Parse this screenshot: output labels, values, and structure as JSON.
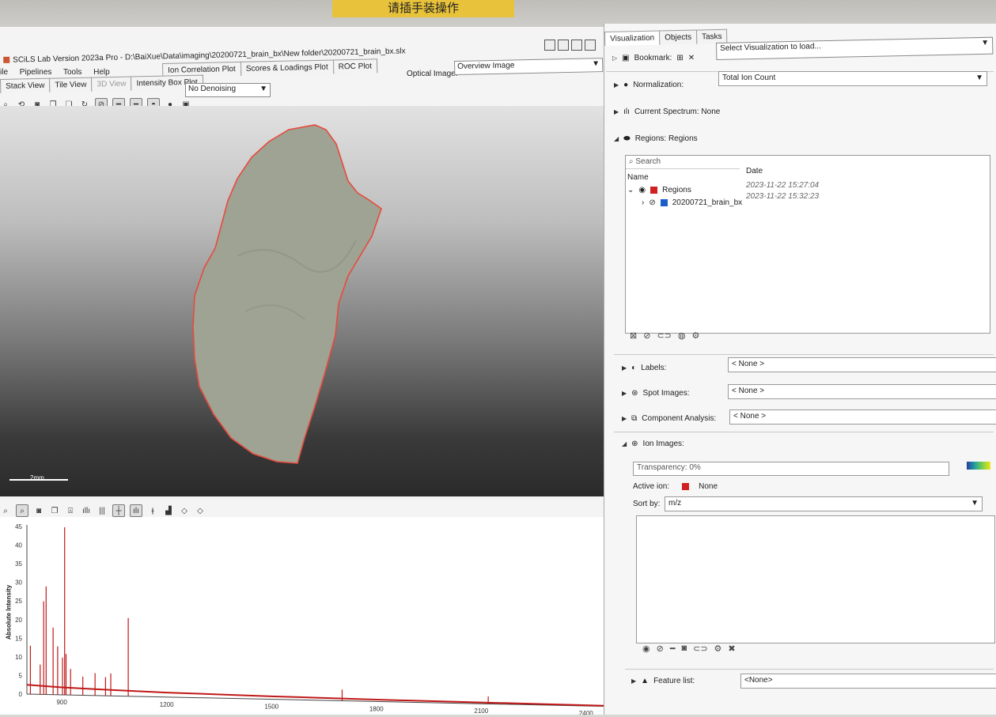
{
  "banner": {
    "text": "请插手装操作"
  },
  "window": {
    "title": "SCiLS Lab Version 2023a Pro - D:\\BaiXue\\Data\\imaging\\20200721_brain_bx\\New folder\\20200721_brain_bx.slx"
  },
  "menu": [
    "ile",
    "Pipelines",
    "Tools",
    "Help"
  ],
  "plot_tabs": [
    "Ion Correlation Plot",
    "Scores & Loadings Plot",
    "ROC Plot"
  ],
  "view_tabs": [
    "Stack View",
    "Tile View",
    "3D View",
    "Intensity Box Plot"
  ],
  "optical": {
    "label": "Optical Image:",
    "value": "Overview Image"
  },
  "denoise": {
    "value": "No Denoising"
  },
  "scale_bar": {
    "label": "2mm"
  },
  "spectrum": {
    "ylabel": "Absolute Intensity",
    "yticks": [
      "45",
      "40",
      "35",
      "30",
      "25",
      "20",
      "15",
      "10",
      "5",
      "0"
    ],
    "xticks": [
      "900",
      "1200",
      "1500",
      "1800",
      "2100",
      "2400"
    ]
  },
  "chart_data": {
    "type": "line",
    "title": "",
    "xlabel": "",
    "ylabel": "Absolute Intensity",
    "xlim": [
      800,
      2500
    ],
    "ylim": [
      0,
      45
    ],
    "peaks": {
      "x": [
        810,
        838,
        848,
        855,
        875,
        888,
        902,
        908,
        912,
        925,
        960,
        995,
        1025,
        1040,
        1090,
        1702,
        2120
      ],
      "y": [
        13,
        8,
        25,
        29,
        18,
        13,
        10,
        45,
        11,
        7,
        5,
        6,
        5,
        6,
        21,
        3,
        2
      ]
    },
    "baseline": {
      "x": [
        780,
        900,
        1000,
        1200,
        1500,
        1800,
        2100,
        2400,
        2500
      ],
      "y": [
        2.5,
        2,
        1.7,
        1.2,
        0.8,
        0.5,
        0.35,
        0.2,
        0.15
      ]
    }
  },
  "right_tabs": [
    "Visualization",
    "Objects",
    "Tasks"
  ],
  "bookmark": {
    "label": "Bookmark:",
    "value": "Select Visualization to load..."
  },
  "normalization": {
    "label": "Normalization:",
    "value": "Total Ion Count"
  },
  "current_spectrum": {
    "label": "Current Spectrum: None"
  },
  "regions": {
    "header": "Regions: Regions",
    "search_placeholder": "Search",
    "col_name": "Name",
    "col_date": "Date",
    "rows": [
      {
        "name": "Regions",
        "date": "2023-11-22 15:27:04",
        "color": "#d02020"
      },
      {
        "name": "20200721_brain_bx",
        "date": "2023-11-22 15:32:23",
        "color": "#1a5fc8"
      }
    ]
  },
  "labels": {
    "label": "Labels:",
    "value": "< None >"
  },
  "spot_images": {
    "label": "Spot Images:",
    "value": "< None >"
  },
  "component_analysis": {
    "label": "Component Analysis:",
    "value": "< None >"
  },
  "ion_images": {
    "header": "Ion Images:",
    "transparency": "Transparency: 0%",
    "active_ion_label": "Active ion:",
    "active_ion_value": "None",
    "sort_label": "Sort by:",
    "sort_value": "m/z"
  },
  "feature_list": {
    "label": "Feature list:",
    "value": "<None>"
  }
}
